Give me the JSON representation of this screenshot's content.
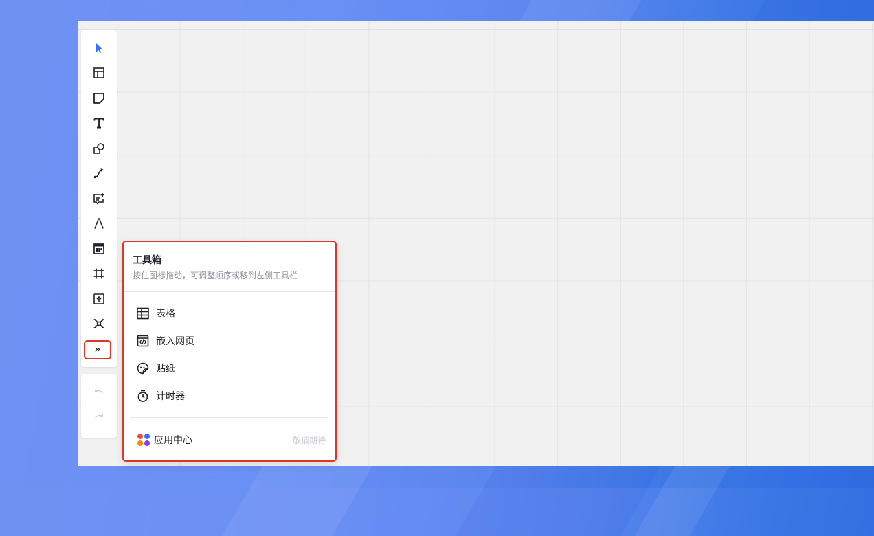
{
  "toolbar": {
    "tools": [
      {
        "name": "select-tool",
        "icon": "cursor-arrow-icon"
      },
      {
        "name": "template-tool",
        "icon": "layout-template-icon"
      },
      {
        "name": "sticky-note-tool",
        "icon": "sticky-note-icon"
      },
      {
        "name": "text-tool",
        "icon": "text-T-icon"
      },
      {
        "name": "shape-tool",
        "icon": "shapes-icon"
      },
      {
        "name": "connector-tool",
        "icon": "connector-line-icon"
      },
      {
        "name": "comment-tool",
        "icon": "comment-add-icon"
      },
      {
        "name": "pen-tool",
        "icon": "pen-icon"
      },
      {
        "name": "kanban-tool",
        "icon": "kanban-icon"
      },
      {
        "name": "frame-tool",
        "icon": "frame-hash-icon"
      },
      {
        "name": "upload-tool",
        "icon": "upload-icon"
      },
      {
        "name": "mindmap-tool",
        "icon": "mindmap-icon"
      }
    ],
    "more_label": "»"
  },
  "history": {
    "undo_icon": "undo-icon",
    "redo_icon": "redo-icon"
  },
  "toolbox": {
    "title": "工具箱",
    "subtitle": "按住图标拖动，可调整顺序或移到左侧工具栏",
    "items": [
      {
        "label": "表格",
        "icon": "table-icon"
      },
      {
        "label": "嵌入网页",
        "icon": "embed-webpage-icon"
      },
      {
        "label": "贴纸",
        "icon": "sticker-icon"
      },
      {
        "label": "计时器",
        "icon": "timer-icon"
      }
    ],
    "footer": {
      "label": "应用中心",
      "tag": "敬请期待",
      "icon": "app-center-icon"
    }
  },
  "colors": {
    "accent": "#3370ff",
    "highlight_border": "#e0362a",
    "text": "#1f2329",
    "muted": "#8f959e",
    "disabled": "#c9cdd4"
  }
}
